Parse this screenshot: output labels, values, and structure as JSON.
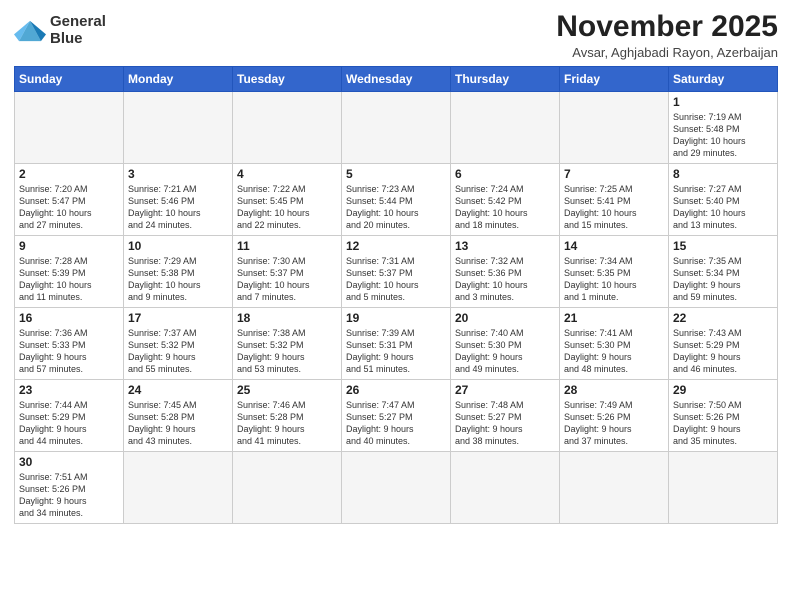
{
  "logo": {
    "line1": "General",
    "line2": "Blue"
  },
  "title": "November 2025",
  "subtitle": "Avsar, Aghjabadi Rayon, Azerbaijan",
  "weekdays": [
    "Sunday",
    "Monday",
    "Tuesday",
    "Wednesday",
    "Thursday",
    "Friday",
    "Saturday"
  ],
  "weeks": [
    [
      {
        "day": "",
        "info": ""
      },
      {
        "day": "",
        "info": ""
      },
      {
        "day": "",
        "info": ""
      },
      {
        "day": "",
        "info": ""
      },
      {
        "day": "",
        "info": ""
      },
      {
        "day": "",
        "info": ""
      },
      {
        "day": "1",
        "info": "Sunrise: 7:19 AM\nSunset: 5:48 PM\nDaylight: 10 hours\nand 29 minutes."
      }
    ],
    [
      {
        "day": "2",
        "info": "Sunrise: 7:20 AM\nSunset: 5:47 PM\nDaylight: 10 hours\nand 27 minutes."
      },
      {
        "day": "3",
        "info": "Sunrise: 7:21 AM\nSunset: 5:46 PM\nDaylight: 10 hours\nand 24 minutes."
      },
      {
        "day": "4",
        "info": "Sunrise: 7:22 AM\nSunset: 5:45 PM\nDaylight: 10 hours\nand 22 minutes."
      },
      {
        "day": "5",
        "info": "Sunrise: 7:23 AM\nSunset: 5:44 PM\nDaylight: 10 hours\nand 20 minutes."
      },
      {
        "day": "6",
        "info": "Sunrise: 7:24 AM\nSunset: 5:42 PM\nDaylight: 10 hours\nand 18 minutes."
      },
      {
        "day": "7",
        "info": "Sunrise: 7:25 AM\nSunset: 5:41 PM\nDaylight: 10 hours\nand 15 minutes."
      },
      {
        "day": "8",
        "info": "Sunrise: 7:27 AM\nSunset: 5:40 PM\nDaylight: 10 hours\nand 13 minutes."
      }
    ],
    [
      {
        "day": "9",
        "info": "Sunrise: 7:28 AM\nSunset: 5:39 PM\nDaylight: 10 hours\nand 11 minutes."
      },
      {
        "day": "10",
        "info": "Sunrise: 7:29 AM\nSunset: 5:38 PM\nDaylight: 10 hours\nand 9 minutes."
      },
      {
        "day": "11",
        "info": "Sunrise: 7:30 AM\nSunset: 5:37 PM\nDaylight: 10 hours\nand 7 minutes."
      },
      {
        "day": "12",
        "info": "Sunrise: 7:31 AM\nSunset: 5:37 PM\nDaylight: 10 hours\nand 5 minutes."
      },
      {
        "day": "13",
        "info": "Sunrise: 7:32 AM\nSunset: 5:36 PM\nDaylight: 10 hours\nand 3 minutes."
      },
      {
        "day": "14",
        "info": "Sunrise: 7:34 AM\nSunset: 5:35 PM\nDaylight: 10 hours\nand 1 minute."
      },
      {
        "day": "15",
        "info": "Sunrise: 7:35 AM\nSunset: 5:34 PM\nDaylight: 9 hours\nand 59 minutes."
      }
    ],
    [
      {
        "day": "16",
        "info": "Sunrise: 7:36 AM\nSunset: 5:33 PM\nDaylight: 9 hours\nand 57 minutes."
      },
      {
        "day": "17",
        "info": "Sunrise: 7:37 AM\nSunset: 5:32 PM\nDaylight: 9 hours\nand 55 minutes."
      },
      {
        "day": "18",
        "info": "Sunrise: 7:38 AM\nSunset: 5:32 PM\nDaylight: 9 hours\nand 53 minutes."
      },
      {
        "day": "19",
        "info": "Sunrise: 7:39 AM\nSunset: 5:31 PM\nDaylight: 9 hours\nand 51 minutes."
      },
      {
        "day": "20",
        "info": "Sunrise: 7:40 AM\nSunset: 5:30 PM\nDaylight: 9 hours\nand 49 minutes."
      },
      {
        "day": "21",
        "info": "Sunrise: 7:41 AM\nSunset: 5:30 PM\nDaylight: 9 hours\nand 48 minutes."
      },
      {
        "day": "22",
        "info": "Sunrise: 7:43 AM\nSunset: 5:29 PM\nDaylight: 9 hours\nand 46 minutes."
      }
    ],
    [
      {
        "day": "23",
        "info": "Sunrise: 7:44 AM\nSunset: 5:29 PM\nDaylight: 9 hours\nand 44 minutes."
      },
      {
        "day": "24",
        "info": "Sunrise: 7:45 AM\nSunset: 5:28 PM\nDaylight: 9 hours\nand 43 minutes."
      },
      {
        "day": "25",
        "info": "Sunrise: 7:46 AM\nSunset: 5:28 PM\nDaylight: 9 hours\nand 41 minutes."
      },
      {
        "day": "26",
        "info": "Sunrise: 7:47 AM\nSunset: 5:27 PM\nDaylight: 9 hours\nand 40 minutes."
      },
      {
        "day": "27",
        "info": "Sunrise: 7:48 AM\nSunset: 5:27 PM\nDaylight: 9 hours\nand 38 minutes."
      },
      {
        "day": "28",
        "info": "Sunrise: 7:49 AM\nSunset: 5:26 PM\nDaylight: 9 hours\nand 37 minutes."
      },
      {
        "day": "29",
        "info": "Sunrise: 7:50 AM\nSunset: 5:26 PM\nDaylight: 9 hours\nand 35 minutes."
      }
    ],
    [
      {
        "day": "30",
        "info": "Sunrise: 7:51 AM\nSunset: 5:26 PM\nDaylight: 9 hours\nand 34 minutes."
      },
      {
        "day": "",
        "info": ""
      },
      {
        "day": "",
        "info": ""
      },
      {
        "day": "",
        "info": ""
      },
      {
        "day": "",
        "info": ""
      },
      {
        "day": "",
        "info": ""
      },
      {
        "day": "",
        "info": ""
      }
    ]
  ]
}
